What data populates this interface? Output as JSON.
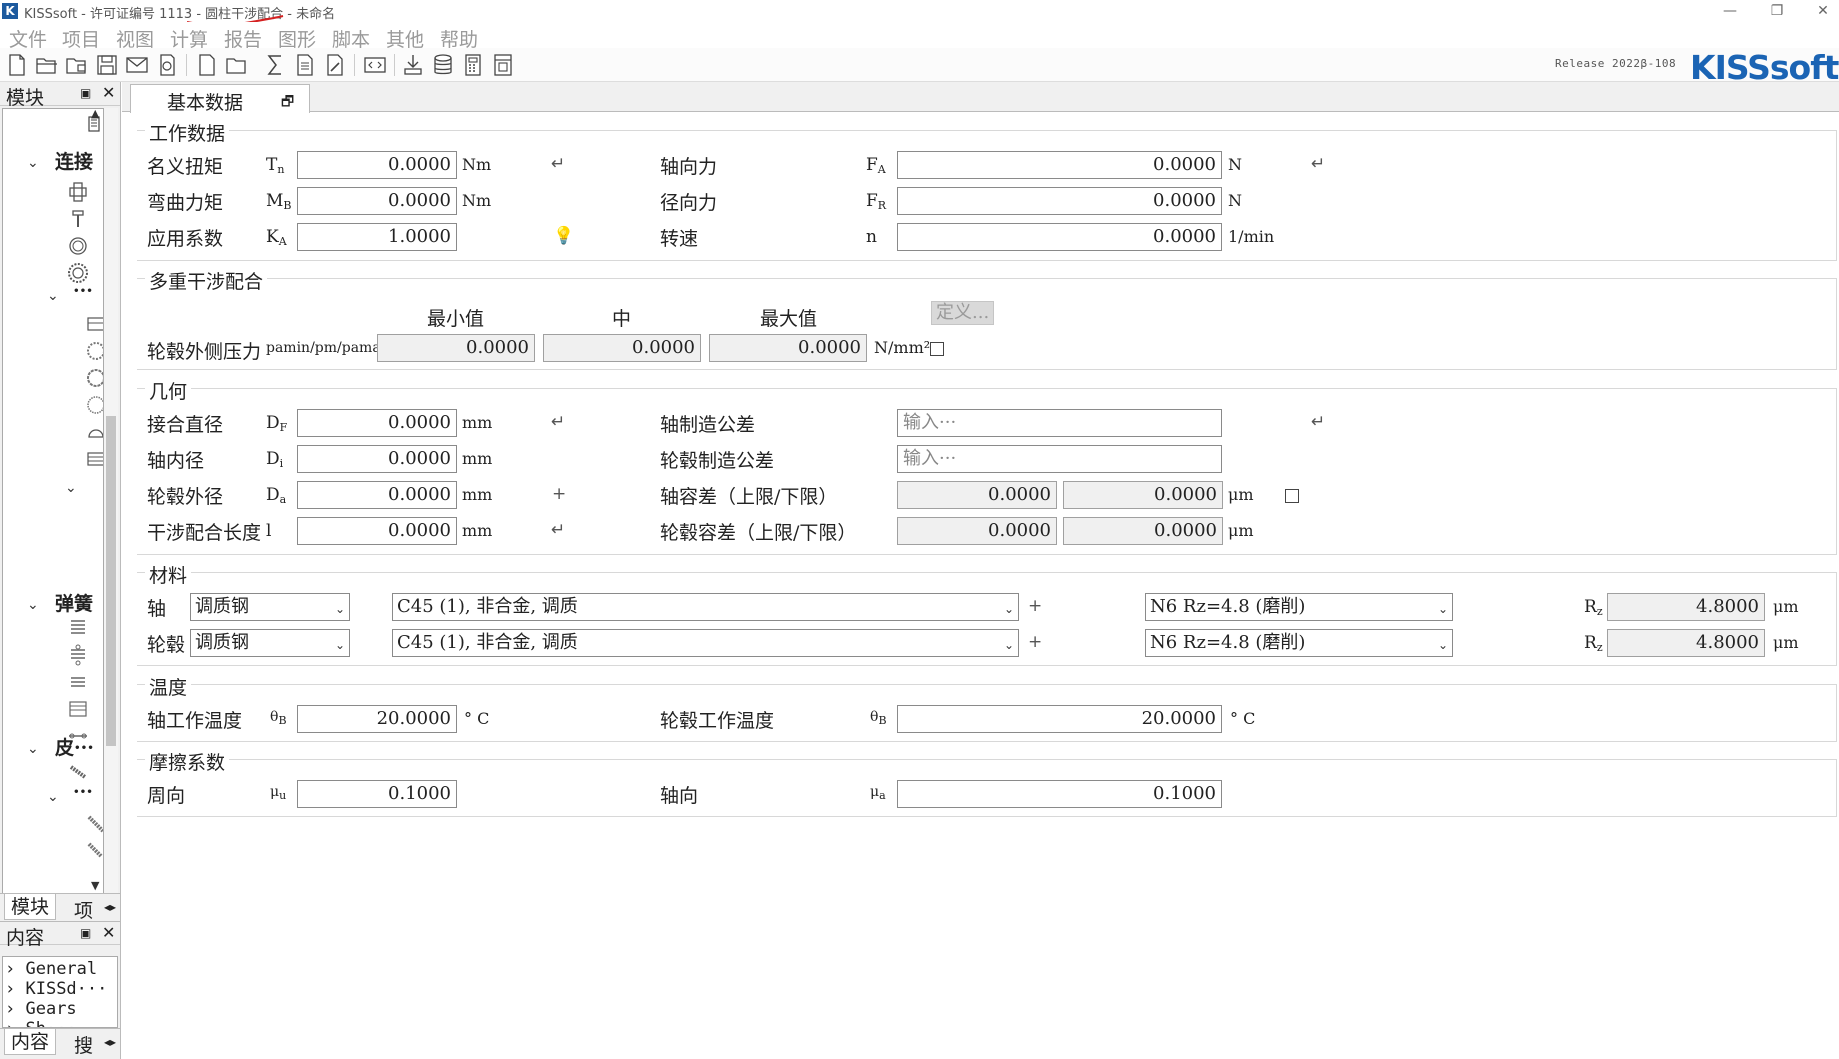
{
  "window": {
    "title": "KISSsoft - 许可证编号 1113 - 圆柱干涉配合 - 未命名",
    "logo_letter": "K"
  },
  "menu": [
    "文件",
    "项目",
    "视图",
    "计算",
    "报告",
    "图形",
    "脚本",
    "其他",
    "帮助"
  ],
  "toolbar": {
    "release": "Release 2022β-108",
    "brand": "KISSsoft"
  },
  "left_panel": {
    "modules_title": "模块",
    "tree": {
      "node_connection": "连接",
      "node_ellipsis_1": "···",
      "node_spring": "弹簧",
      "node_belt": "皮···",
      "node_ellipsis_2": "···"
    },
    "bottom_tabs": [
      "模块",
      "项"
    ],
    "contents_title": "内容",
    "contents_items": [
      "General",
      "KISSd···",
      "Gears",
      "Sh···"
    ],
    "contents_tabs": [
      "内容",
      "搜"
    ]
  },
  "main": {
    "tab_label": "基本数据",
    "groups": {
      "operating": {
        "title": "工作数据",
        "nominal_torque": {
          "label": "名义扭矩",
          "symbol": "T",
          "sub": "n",
          "value": "0.0000",
          "unit": "Nm"
        },
        "bending_moment": {
          "label": "弯曲力矩",
          "symbol": "M",
          "sub": "B",
          "value": "0.0000",
          "unit": "Nm"
        },
        "application_factor": {
          "label": "应用系数",
          "symbol": "K",
          "sub": "A",
          "value": "1.0000"
        },
        "axial_force": {
          "label": "轴向力",
          "symbol": "F",
          "sub": "A",
          "value": "0.0000",
          "unit": "N"
        },
        "radial_force": {
          "label": "径向力",
          "symbol": "F",
          "sub": "R",
          "value": "0.0000",
          "unit": "N"
        },
        "speed": {
          "label": "转速",
          "symbol": "n",
          "value": "0.0000",
          "unit": "1/min"
        }
      },
      "multiple": {
        "title": "多重干涉配合",
        "col_min": "最小值",
        "col_mid": "中",
        "col_max": "最大值",
        "define_button": "定义...",
        "pressure_label": "轮毂外侧压力",
        "pressure_symbols": "pamin/pm/pamax",
        "p_min": "0.0000",
        "p_mid": "0.0000",
        "p_max": "0.0000",
        "unit": "N/mm²"
      },
      "geometry": {
        "title": "几何",
        "joint_diameter": {
          "label": "接合直径",
          "symbol": "D",
          "sub": "F",
          "value": "0.0000",
          "unit": "mm"
        },
        "shaft_inner_diameter": {
          "label": "轴内径",
          "symbol": "D",
          "sub": "i",
          "value": "0.0000",
          "unit": "mm"
        },
        "hub_outer_diameter": {
          "label": "轮毂外径",
          "symbol": "D",
          "sub": "a",
          "value": "0.0000",
          "unit": "mm"
        },
        "fit_length": {
          "label": "干涉配合长度",
          "symbol": "l",
          "value": "0.0000",
          "unit": "mm"
        },
        "shaft_tolerance": {
          "label": "轴制造公差",
          "placeholder": "输入···"
        },
        "hub_tolerance": {
          "label": "轮毂制造公差",
          "placeholder": "输入···"
        },
        "shaft_allowance": {
          "label": "轴容差（上限/下限）",
          "upper": "0.0000",
          "lower": "0.0000",
          "unit": "μm"
        },
        "hub_allowance": {
          "label": "轮毂容差（上限/下限）",
          "upper": "0.0000",
          "lower": "0.0000",
          "unit": "μm"
        }
      },
      "material": {
        "title": "材料",
        "shaft": {
          "label": "轴",
          "type": "调质钢",
          "material": "C45 (1), 非合金, 调质",
          "surface": "N6 Rz=4.8 (磨削)",
          "rz_symbol": "R",
          "rz_sub": "z",
          "rz_value": "4.8000",
          "rz_unit": "μm"
        },
        "hub": {
          "label": "轮毂",
          "type": "调质钢",
          "material": "C45 (1), 非合金, 调质",
          "surface": "N6 Rz=4.8 (磨削)",
          "rz_symbol": "R",
          "rz_sub": "z",
          "rz_value": "4.8000",
          "rz_unit": "μm"
        }
      },
      "temperature": {
        "title": "温度",
        "shaft_temp": {
          "label": "轴工作温度",
          "symbol": "θ",
          "sub": "B",
          "value": "20.0000",
          "unit": "° C"
        },
        "hub_temp": {
          "label": "轮毂工作温度",
          "symbol": "θ",
          "sub": "B",
          "value": "20.0000",
          "unit": "° C"
        }
      },
      "friction": {
        "title": "摩擦系数",
        "circumferential": {
          "label": "周向",
          "symbol": "μ",
          "sub": "u",
          "value": "0.1000"
        },
        "axial": {
          "label": "轴向",
          "symbol": "μ",
          "sub": "a",
          "value": "0.1000"
        }
      }
    }
  }
}
